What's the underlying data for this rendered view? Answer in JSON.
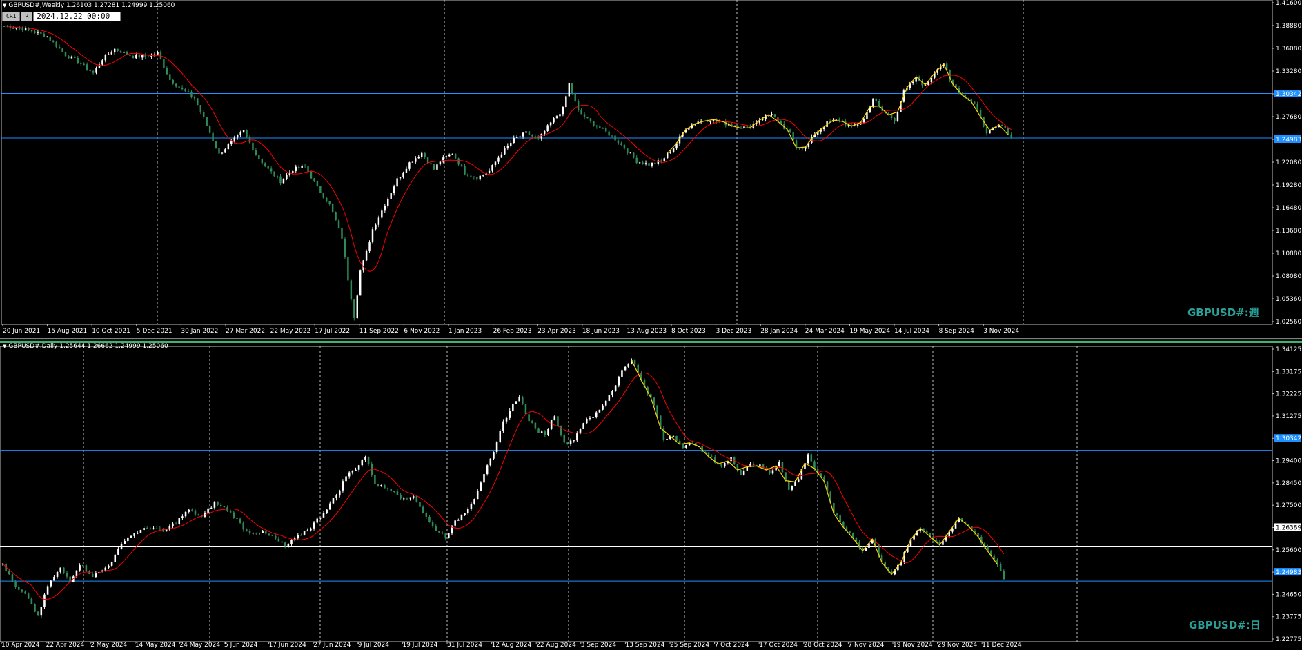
{
  "weekly": {
    "header": "GBPUSD#,Weekly  1.26103 1.27281 1.24999 1.25060",
    "watermark": "GBPUSD#:週",
    "toolbar": {
      "chip1": "CR1",
      "chip2": "R",
      "date": "2024.12.22 00:00"
    },
    "price_labels": [
      "1.41600",
      "1.38880",
      "1.36080",
      "1.33280",
      "1.30342",
      "1.27680",
      "1.24983",
      "1.22080",
      "1.19280",
      "1.16480",
      "1.13680",
      "1.10880",
      "1.08080",
      "1.05360",
      "1.02560"
    ],
    "date_labels": [
      "20 Jun 2021",
      "15 Aug 2021",
      "10 Oct 2021",
      "5 Dec 2021",
      "30 Jan 2022",
      "27 Mar 2022",
      "22 May 2022",
      "17 Jul 2022",
      "11 Sep 2022",
      "6 Nov 2022",
      "1 Jan 2023",
      "26 Feb 2023",
      "23 Apr 2023",
      "18 Jun 2023",
      "13 Aug 2023",
      "8 Oct 2023",
      "3 Dec 2023",
      "28 Jan 2024",
      "24 Mar 2024",
      "19 May 2024",
      "14 Jul 2024",
      "8 Sep 2024",
      "3 Nov 2024"
    ]
  },
  "daily": {
    "header": "GBPUSD#,Daily  1.25644 1.26662 1.24999 1.25060",
    "watermark": "GBPUSD#:日",
    "price_labels": [
      "1.34125",
      "1.33175",
      "1.32225",
      "1.31275",
      "1.30342",
      "1.29400",
      "1.28450",
      "1.27500",
      "1.26389",
      "1.25600",
      "1.24983",
      "1.24650",
      "1.23775",
      "1.22775"
    ],
    "date_labels": [
      "10 Apr 2024",
      "22 Apr 2024",
      "2 May 2024",
      "14 May 2024",
      "24 May 2024",
      "5 Jun 2024",
      "17 Jun 2024",
      "27 Jun 2024",
      "9 Jul 2024",
      "19 Jul 2024",
      "31 Jul 2024",
      "12 Aug 2024",
      "22 Aug 2024",
      "3 Sep 2024",
      "13 Sep 2024",
      "25 Sep 2024",
      "7 Oct 2024",
      "17 Oct 2024",
      "28 Oct 2024",
      "7 Nov 2024",
      "19 Nov 2024",
      "29 Nov 2024",
      "11 Dec 2024"
    ]
  },
  "chart_data": [
    {
      "type": "candlestick",
      "symbol": "GBPUSD#",
      "timeframe": "Weekly",
      "ohlc_last": {
        "open": 1.26103,
        "high": 1.27281,
        "low": 1.24999,
        "close": 1.2506
      },
      "ylim": [
        1.0256,
        1.416
      ],
      "horizontal_levels": [
        {
          "value": 1.30342,
          "color": "#1e90ff"
        },
        {
          "value": 1.24983,
          "color": "#1e90ff"
        }
      ],
      "indicators": [
        {
          "name": "moving-average",
          "color": "#ff0000"
        },
        {
          "name": "zigzag",
          "color": "#ffd700"
        }
      ],
      "colors": {
        "bull": "#ffffff",
        "bear": "#2e8b57",
        "background": "#000000"
      },
      "close_path": [
        [
          0,
          1.385
        ],
        [
          8,
          1.38
        ],
        [
          14,
          1.372
        ],
        [
          20,
          1.35
        ],
        [
          24,
          1.342
        ],
        [
          29,
          1.328
        ],
        [
          32,
          1.345
        ],
        [
          36,
          1.357
        ],
        [
          42,
          1.348
        ],
        [
          46,
          1.348
        ],
        [
          50,
          1.352
        ],
        [
          54,
          1.32
        ],
        [
          58,
          1.308
        ],
        [
          62,
          1.298
        ],
        [
          66,
          1.265
        ],
        [
          70,
          1.23
        ],
        [
          74,
          1.245
        ],
        [
          78,
          1.258
        ],
        [
          82,
          1.23
        ],
        [
          86,
          1.212
        ],
        [
          90,
          1.198
        ],
        [
          94,
          1.212
        ],
        [
          98,
          1.216
        ],
        [
          102,
          1.19
        ],
        [
          106,
          1.17
        ],
        [
          110,
          1.13
        ],
        [
          112,
          1.08
        ],
        [
          114,
          1.035
        ],
        [
          116,
          1.09
        ],
        [
          118,
          1.112
        ],
        [
          120,
          1.14
        ],
        [
          124,
          1.17
        ],
        [
          128,
          1.2
        ],
        [
          132,
          1.22
        ],
        [
          136,
          1.232
        ],
        [
          140,
          1.212
        ],
        [
          142,
          1.222
        ],
        [
          146,
          1.232
        ],
        [
          150,
          1.208
        ],
        [
          154,
          1.202
        ],
        [
          158,
          1.21
        ],
        [
          162,
          1.232
        ],
        [
          166,
          1.248
        ],
        [
          170,
          1.256
        ],
        [
          174,
          1.248
        ],
        [
          178,
          1.268
        ],
        [
          182,
          1.285
        ],
        [
          184,
          1.315
        ],
        [
          187,
          1.282
        ],
        [
          190,
          1.272
        ],
        [
          194,
          1.262
        ],
        [
          198,
          1.252
        ],
        [
          202,
          1.238
        ],
        [
          206,
          1.222
        ],
        [
          210,
          1.218
        ],
        [
          214,
          1.222
        ],
        [
          218,
          1.238
        ],
        [
          222,
          1.262
        ],
        [
          226,
          1.27
        ],
        [
          230,
          1.272
        ],
        [
          234,
          1.268
        ],
        [
          238,
          1.265
        ],
        [
          242,
          1.262
        ],
        [
          246,
          1.272
        ],
        [
          250,
          1.28
        ],
        [
          252,
          1.268
        ],
        [
          256,
          1.255
        ],
        [
          258,
          1.24
        ],
        [
          261,
          1.238
        ],
        [
          264,
          1.255
        ],
        [
          268,
          1.268
        ],
        [
          272,
          1.272
        ],
        [
          276,
          1.262
        ],
        [
          280,
          1.272
        ],
        [
          283,
          1.298
        ],
        [
          286,
          1.282
        ],
        [
          290,
          1.272
        ],
        [
          293,
          1.305
        ],
        [
          297,
          1.322
        ],
        [
          300,
          1.312
        ],
        [
          304,
          1.335
        ],
        [
          306,
          1.34
        ],
        [
          308,
          1.318
        ],
        [
          312,
          1.302
        ],
        [
          316,
          1.292
        ],
        [
          318,
          1.275
        ],
        [
          320,
          1.255
        ],
        [
          322,
          1.262
        ],
        [
          324,
          1.268
        ],
        [
          326,
          1.262
        ],
        [
          328,
          1.25
        ]
      ]
    },
    {
      "type": "candlestick",
      "symbol": "GBPUSD#",
      "timeframe": "Daily",
      "ohlc_last": {
        "open": 1.25644,
        "high": 1.26662,
        "low": 1.24999,
        "close": 1.2506
      },
      "ylim": [
        1.225,
        1.346
      ],
      "horizontal_levels": [
        {
          "value": 1.30342,
          "color": "#1e90ff"
        },
        {
          "value": 1.26389,
          "color": "#ffffff"
        },
        {
          "value": 1.24983,
          "color": "#1e90ff"
        }
      ],
      "indicators": [
        {
          "name": "moving-average",
          "color": "#ff0000"
        },
        {
          "name": "zigzag",
          "color": "#ffd700"
        }
      ],
      "colors": {
        "bull": "#ffffff",
        "bear": "#2e8b57",
        "background": "#000000"
      },
      "close_path": [
        [
          0,
          1.257
        ],
        [
          4,
          1.247
        ],
        [
          8,
          1.243
        ],
        [
          11,
          1.235
        ],
        [
          14,
          1.248
        ],
        [
          18,
          1.255
        ],
        [
          21,
          1.25
        ],
        [
          24,
          1.257
        ],
        [
          28,
          1.252
        ],
        [
          31,
          1.254
        ],
        [
          34,
          1.258
        ],
        [
          38,
          1.267
        ],
        [
          42,
          1.27
        ],
        [
          46,
          1.272
        ],
        [
          50,
          1.27
        ],
        [
          54,
          1.274
        ],
        [
          58,
          1.279
        ],
        [
          62,
          1.276
        ],
        [
          66,
          1.282
        ],
        [
          70,
          1.279
        ],
        [
          73,
          1.275
        ],
        [
          76,
          1.27
        ],
        [
          80,
          1.27
        ],
        [
          84,
          1.268
        ],
        [
          88,
          1.264
        ],
        [
          92,
          1.268
        ],
        [
          96,
          1.272
        ],
        [
          100,
          1.278
        ],
        [
          104,
          1.285
        ],
        [
          107,
          1.293
        ],
        [
          110,
          1.296
        ],
        [
          113,
          1.301
        ],
        [
          116,
          1.29
        ],
        [
          119,
          1.288
        ],
        [
          122,
          1.287
        ],
        [
          125,
          1.283
        ],
        [
          128,
          1.285
        ],
        [
          131,
          1.278
        ],
        [
          134,
          1.272
        ],
        [
          138,
          1.268
        ],
        [
          141,
          1.274
        ],
        [
          144,
          1.278
        ],
        [
          147,
          1.284
        ],
        [
          150,
          1.294
        ],
        [
          153,
          1.302
        ],
        [
          156,
          1.315
        ],
        [
          159,
          1.322
        ],
        [
          161,
          1.326
        ],
        [
          163,
          1.318
        ],
        [
          166,
          1.312
        ],
        [
          169,
          1.31
        ],
        [
          172,
          1.318
        ],
        [
          175,
          1.306
        ],
        [
          178,
          1.308
        ],
        [
          181,
          1.315
        ],
        [
          184,
          1.317
        ],
        [
          187,
          1.322
        ],
        [
          190,
          1.328
        ],
        [
          193,
          1.336
        ],
        [
          196,
          1.341
        ],
        [
          198,
          1.335
        ],
        [
          200,
          1.329
        ],
        [
          203,
          1.322
        ],
        [
          206,
          1.308
        ],
        [
          209,
          1.31
        ],
        [
          212,
          1.304
        ],
        [
          215,
          1.307
        ],
        [
          218,
          1.303
        ],
        [
          221,
          1.3
        ],
        [
          224,
          1.297
        ],
        [
          227,
          1.3
        ],
        [
          230,
          1.294
        ],
        [
          233,
          1.298
        ],
        [
          236,
          1.297
        ],
        [
          239,
          1.294
        ],
        [
          242,
          1.299
        ],
        [
          245,
          1.287
        ],
        [
          248,
          1.292
        ],
        [
          251,
          1.302
        ],
        [
          253,
          1.296
        ],
        [
          256,
          1.29
        ],
        [
          259,
          1.278
        ],
        [
          262,
          1.272
        ],
        [
          265,
          1.268
        ],
        [
          268,
          1.262
        ],
        [
          271,
          1.267
        ],
        [
          274,
          1.258
        ],
        [
          277,
          1.252
        ],
        [
          280,
          1.258
        ],
        [
          283,
          1.267
        ],
        [
          286,
          1.272
        ],
        [
          289,
          1.268
        ],
        [
          292,
          1.265
        ],
        [
          295,
          1.27
        ],
        [
          298,
          1.275
        ],
        [
          301,
          1.272
        ],
        [
          304,
          1.268
        ],
        [
          307,
          1.262
        ],
        [
          310,
          1.257
        ],
        [
          312,
          1.251
        ]
      ]
    }
  ]
}
